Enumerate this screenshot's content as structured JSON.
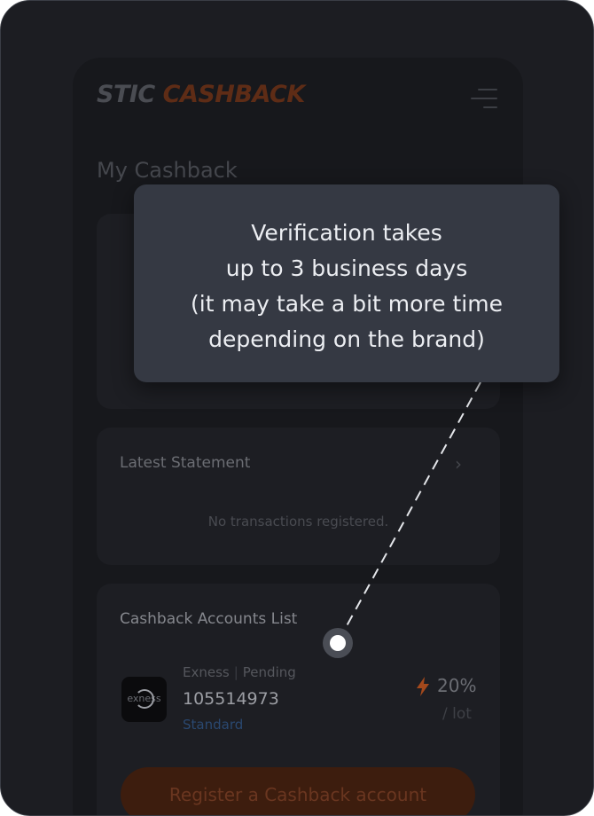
{
  "header": {
    "logo_part1": "STIC ",
    "logo_part2": "CASHBACK",
    "menu_icon": "hamburger-menu-icon"
  },
  "page": {
    "title": "My Cashback"
  },
  "statement": {
    "title": "Latest Statement",
    "empty_text": "No transactions registered.",
    "chevron": "›"
  },
  "accounts": {
    "title": "Cashback Accounts List",
    "items": [
      {
        "broker": "Exness",
        "status": "Pending",
        "number": "105514973",
        "type": "Standard",
        "rate": "20%",
        "unit": "/ lot",
        "logo_text": "exness"
      }
    ],
    "register_label": "Register a Cashback account"
  },
  "tooltip": {
    "lines": [
      "Verification takes",
      "up to 3 business days",
      "(it may take a bit more time",
      "depending on the brand)"
    ]
  },
  "colors": {
    "accent": "#c4551e",
    "tooltip_bg": "#353943",
    "background": "#1c1d22"
  }
}
